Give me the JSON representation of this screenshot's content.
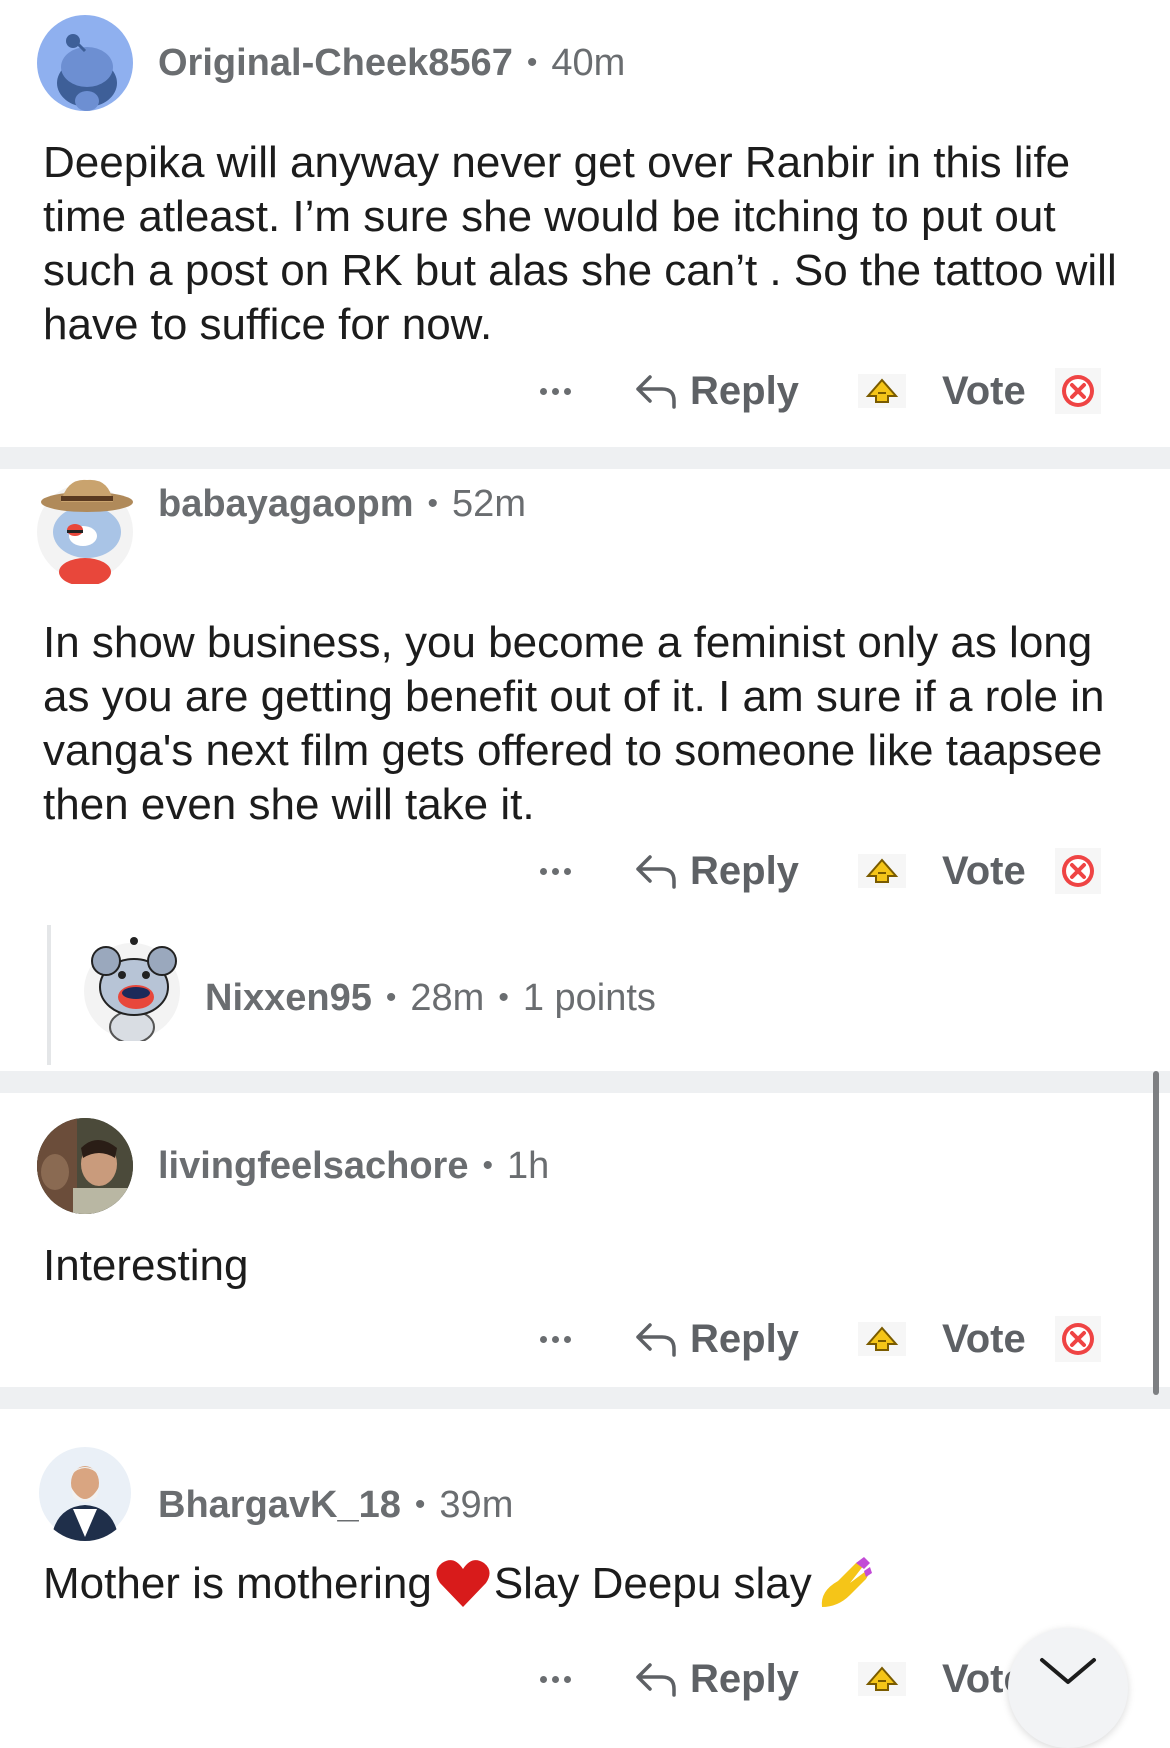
{
  "comments": [
    {
      "username": "Original-Cheek8567",
      "age": "40m",
      "text": "Deepika will anyway never get over Ranbir in this life time atleast. I’m sure she would be itching to put out such a post on RK but alas she can’t . So the tattoo will have to suffice for now.",
      "reply_label": "Reply",
      "vote_label": "Vote"
    },
    {
      "username": "babayagaopm",
      "age": "52m",
      "text": "In show business, you become a feminist only as long as you are getting benefit out of it. I am sure if a role in vanga's next film gets offered to someone like taapsee then even she will take it.",
      "reply_label": "Reply",
      "vote_label": "Vote",
      "replies": [
        {
          "username": "Nixxen95",
          "age": "28m",
          "points": "1 points"
        }
      ]
    },
    {
      "username": "livingfeelsachore",
      "age": "1h",
      "text": "Interesting",
      "reply_label": "Reply",
      "vote_label": "Vote"
    },
    {
      "username": "BhargavK_18",
      "age": "39m",
      "text_a": "Mother is mothering",
      "text_b": "Slay Deepu slay",
      "reply_label": "Reply",
      "vote_label": "Vote"
    }
  ],
  "icons": {
    "more": "more-dots-icon",
    "reply": "reply-arrow-icon",
    "upvote": "upvote-arrow-icon",
    "downvote": "downvote-x-icon",
    "scroll_down": "chevron-down-icon"
  },
  "colors": {
    "separator": "#eef0f2",
    "meta_text": "#6a6d70",
    "upvote": "#f5c518",
    "downvote": "#ef4444"
  }
}
